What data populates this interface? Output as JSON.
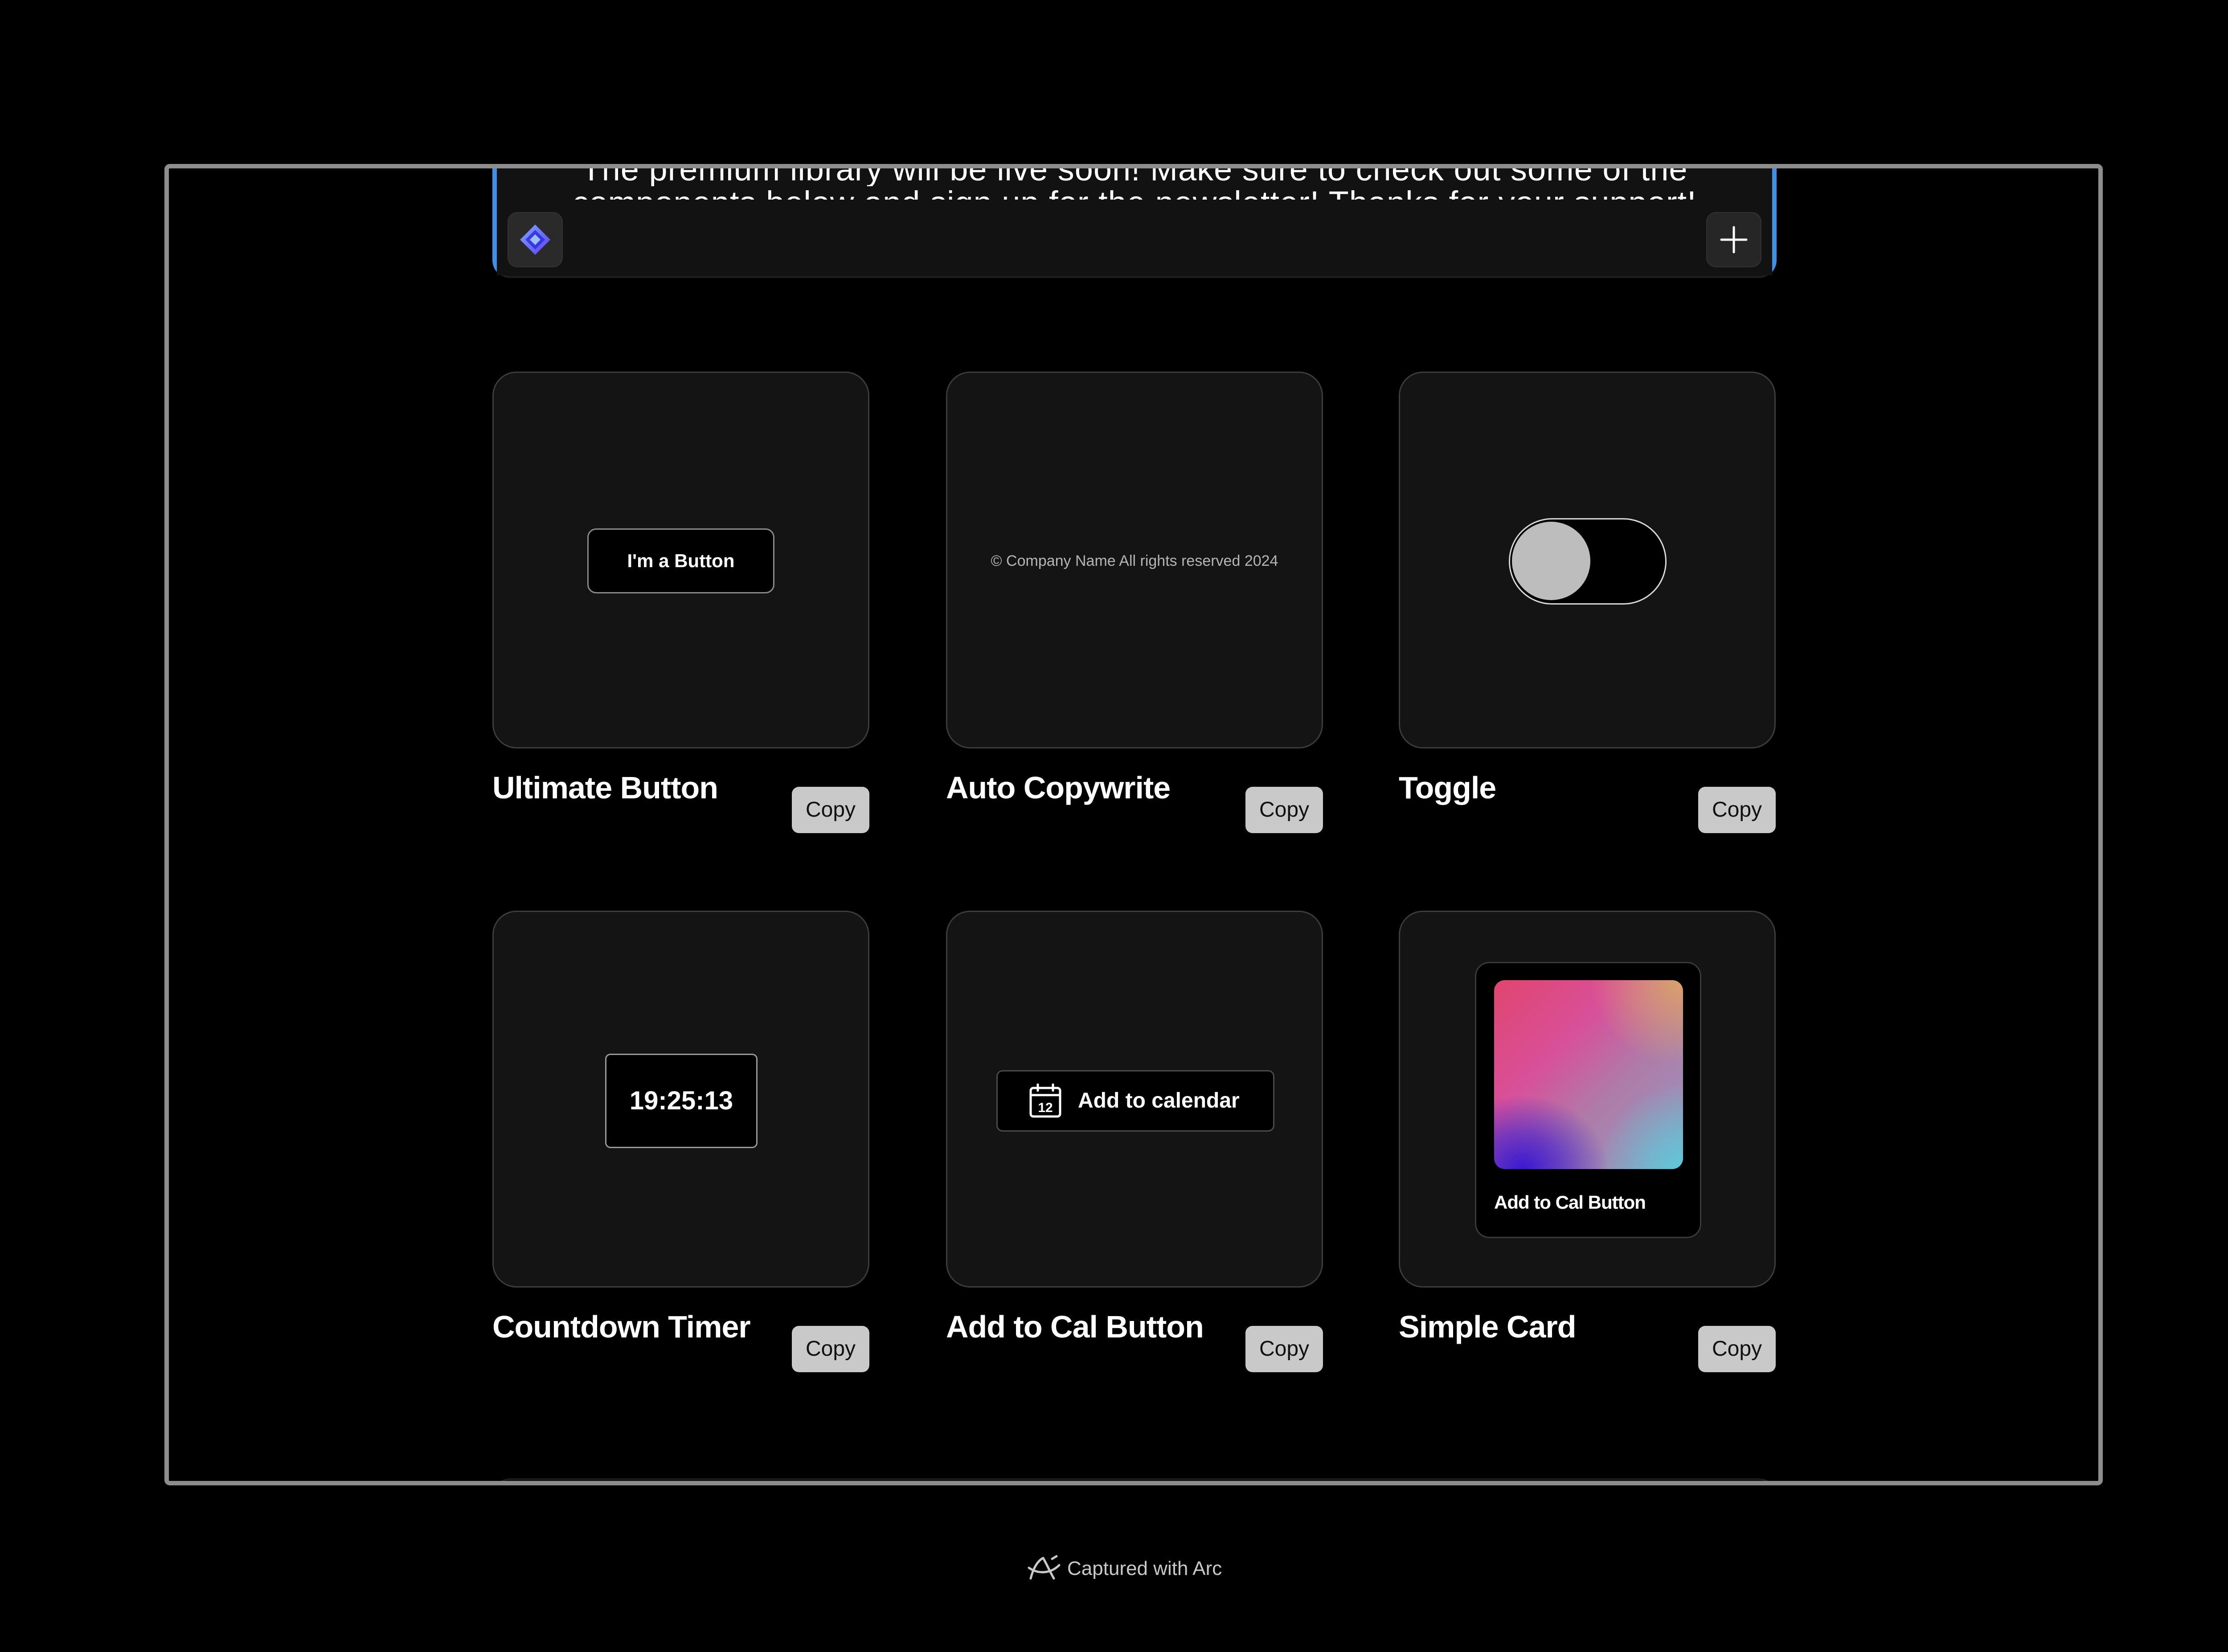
{
  "banner": {
    "line1": "The premium library will be live soon! Make sure to check out some of the",
    "line2": "components below and sign up for the newsletter! Thanks for your support!",
    "logo_icon": "diamond-logo-icon",
    "plus_icon": "plus-icon"
  },
  "components": [
    {
      "title": "Ultimate Button",
      "copy_label": "Copy",
      "preview_label": "I'm a Button"
    },
    {
      "title": "Auto Copywrite",
      "copy_label": "Copy",
      "preview_text": "© Company Name All rights reserved 2024"
    },
    {
      "title": "Toggle",
      "copy_label": "Copy",
      "toggle_state": "off"
    },
    {
      "title": "Countdown Timer",
      "copy_label": "Copy",
      "timer_value": "19:25:13"
    },
    {
      "title": "Add to Cal Button",
      "copy_label": "Copy",
      "preview_label": "Add to calendar",
      "calendar_day": "12"
    },
    {
      "title": "Simple Card",
      "copy_label": "Copy",
      "card_label": "Add to Cal Button"
    }
  ],
  "footer": {
    "captured_label": "Captured with Arc",
    "arc_icon": "arc-logo-icon"
  },
  "colors": {
    "background": "#000000",
    "card": "#141414",
    "accent_border": "#3f8fe6",
    "copy_button": "#c9c9c9"
  }
}
